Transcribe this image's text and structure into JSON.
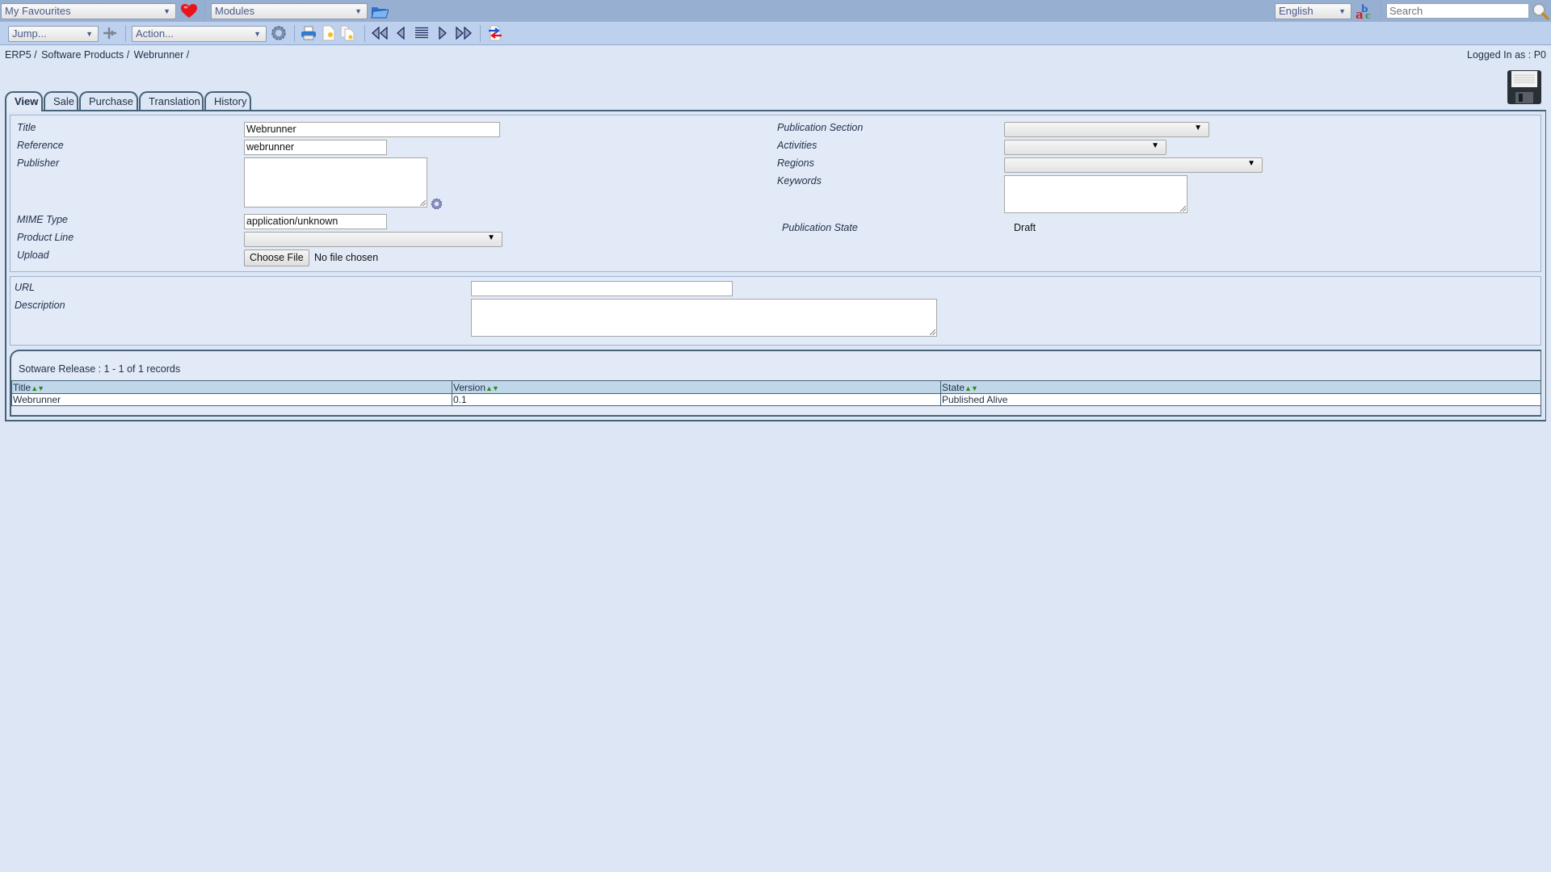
{
  "topbar": {
    "favourites": "My Favourites",
    "modules": "Modules",
    "language": "English",
    "search_placeholder": "Search"
  },
  "toolbar": {
    "jump": "Jump...",
    "action": "Action..."
  },
  "breadcrumb": [
    "ERP5 /",
    "Software Products /",
    "Webrunner /"
  ],
  "logged_in": "Logged In as : P0",
  "tabs": [
    {
      "label": "View",
      "active": true
    },
    {
      "label": "Sale"
    },
    {
      "label": "Purchase"
    },
    {
      "label": "Translation"
    },
    {
      "label": "History"
    }
  ],
  "form": {
    "left": {
      "title_label": "Title",
      "title_value": "Webrunner",
      "reference_label": "Reference",
      "reference_value": "webrunner",
      "publisher_label": "Publisher",
      "publisher_value": "",
      "mime_label": "MIME Type",
      "mime_value": "application/unknown",
      "product_line_label": "Product Line",
      "product_line_value": "",
      "upload_label": "Upload",
      "choose_file": "Choose File",
      "no_file": "No file chosen"
    },
    "right": {
      "publication_section_label": "Publication Section",
      "activities_label": "Activities",
      "regions_label": "Regions",
      "keywords_label": "Keywords",
      "keywords_value": "",
      "publication_state_label": "Publication State",
      "publication_state_value": "Draft"
    },
    "bottom": {
      "url_label": "URL",
      "url_value": "",
      "description_label": "Description",
      "description_value": ""
    }
  },
  "listbox": {
    "title": "Sotware Release :",
    "records": "1 - 1 of 1 records",
    "columns": [
      "Title",
      "Version",
      "State"
    ],
    "rows": [
      [
        "Webrunner",
        "0.1",
        "Published Alive"
      ]
    ]
  },
  "colors": {
    "topbar": "#97afd0",
    "toolbar": "#bdd1ef",
    "page": "#dce6f5",
    "header_row": "#c0d7ea",
    "border": "#466278"
  }
}
